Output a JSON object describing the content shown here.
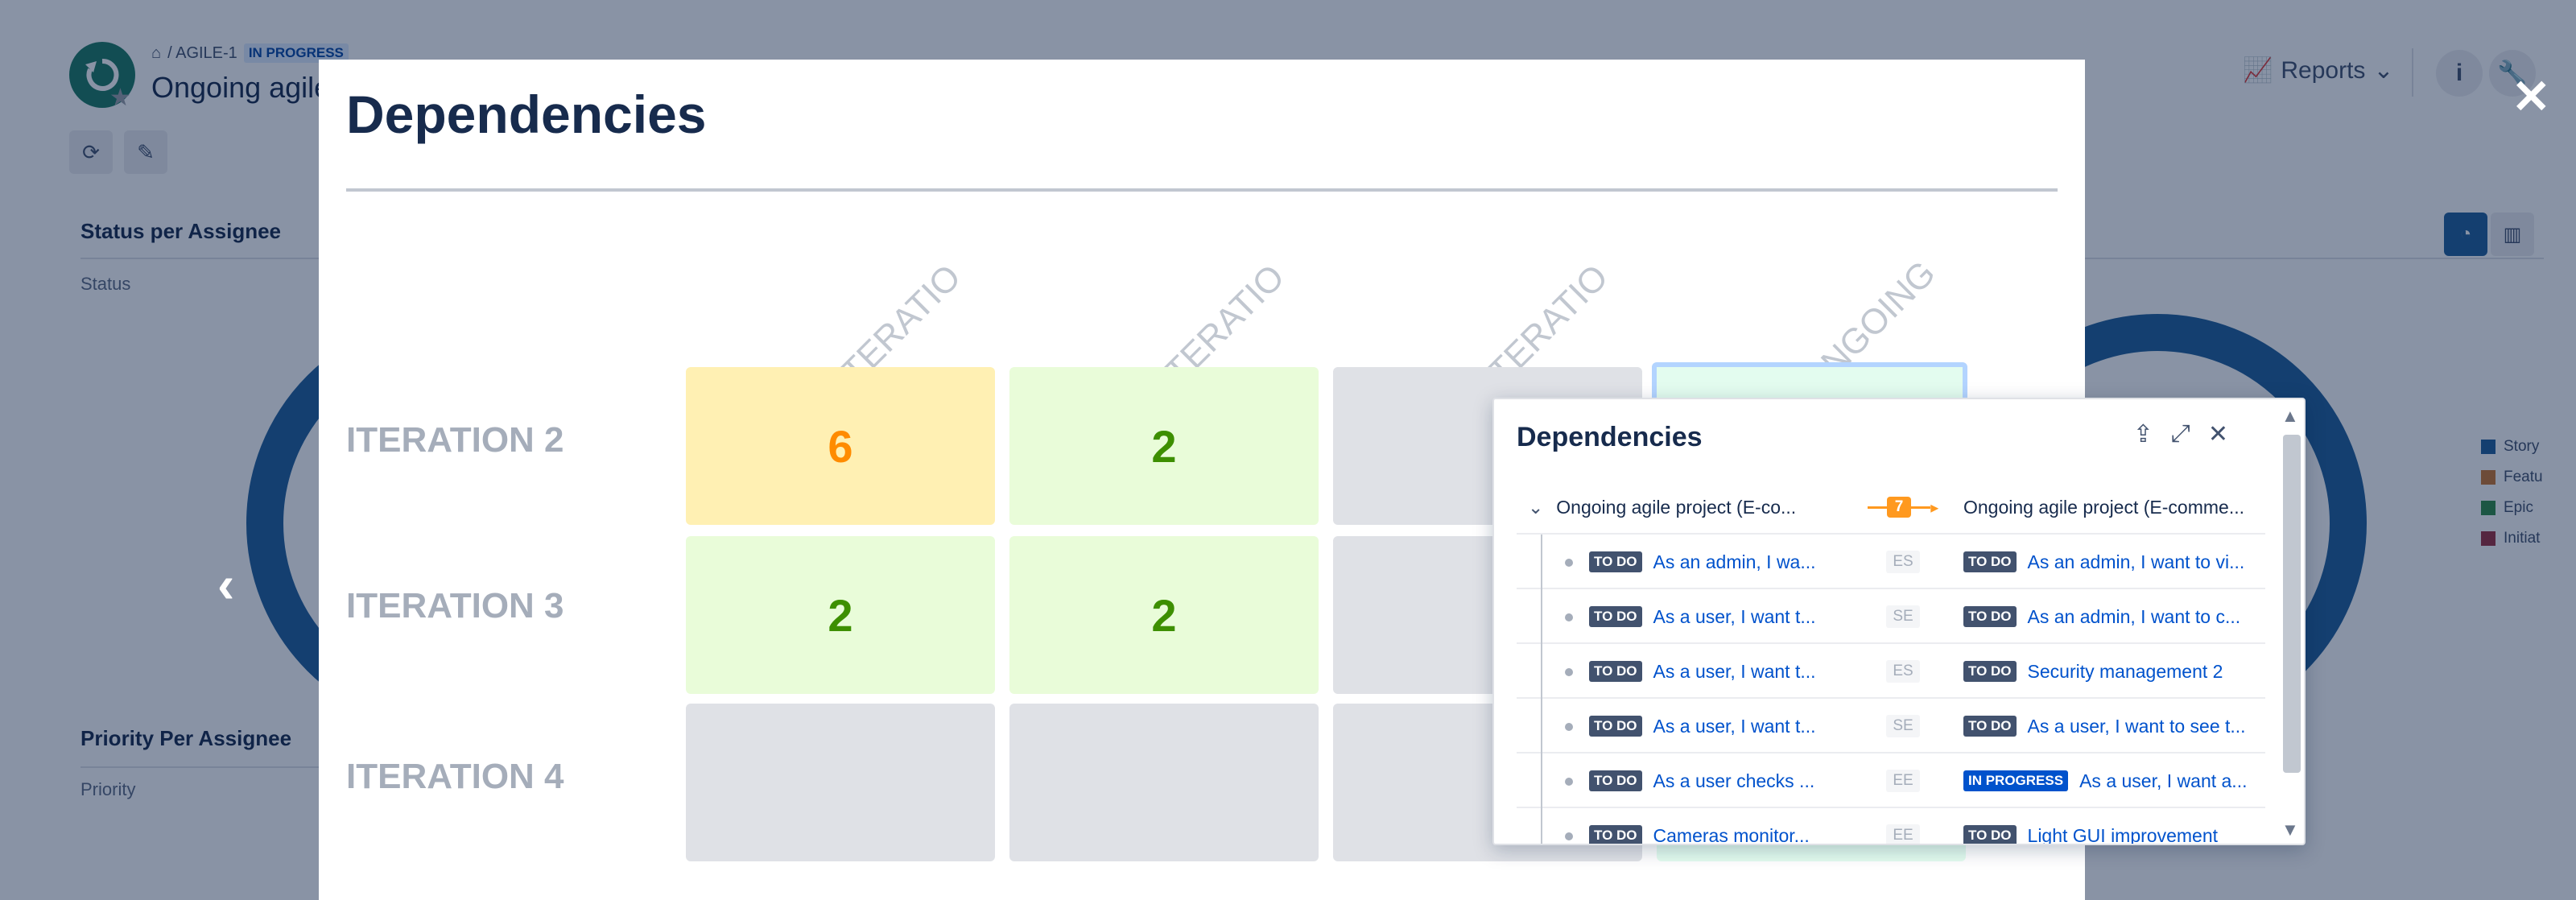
{
  "background": {
    "breadcrumb_key": "/ AGILE-1",
    "status": "IN PROGRESS",
    "title": "Ongoing agile",
    "reports_label": "Reports",
    "info_label": "i",
    "sections": [
      {
        "title": "Status per Assignee",
        "subtitle": "Status"
      },
      {
        "title": "Priority Per Assignee",
        "subtitle": "Priority"
      }
    ],
    "legend": [
      {
        "label": "Story",
        "color": "#1f5e99"
      },
      {
        "label": "Featu",
        "color": "#c9762f"
      },
      {
        "label": "Epic",
        "color": "#2f8a45"
      },
      {
        "label": "Initiat",
        "color": "#9b2f3f"
      }
    ]
  },
  "modal": {
    "title": "Dependencies",
    "column_headers": [
      "ITERATIO",
      "ITERATIO",
      "ITERATIO",
      "ONGOING"
    ],
    "rows": [
      {
        "label": "ITERATION 2",
        "cells": [
          "6",
          "2",
          "",
          ""
        ]
      },
      {
        "label": "ITERATION 3",
        "cells": [
          "2",
          "2",
          "",
          ""
        ]
      },
      {
        "label": "ITERATION 4",
        "cells": [
          "",
          "",
          "",
          ""
        ]
      }
    ]
  },
  "popup": {
    "title": "Dependencies",
    "group": {
      "left": "Ongoing agile project (E-co...",
      "count": "7",
      "right": "Ongoing agile project (E-comme..."
    },
    "items": [
      {
        "left_status": "TO DO",
        "left_text": "As an admin, I wa...",
        "type": "ES",
        "right_status": "TO DO",
        "right_text": "As an admin, I want to vi..."
      },
      {
        "left_status": "TO DO",
        "left_text": "As a user, I want t...",
        "type": "SE",
        "right_status": "TO DO",
        "right_text": "As an admin, I want to c..."
      },
      {
        "left_status": "TO DO",
        "left_text": "As a user, I want t...",
        "type": "ES",
        "right_status": "TO DO",
        "right_text": "Security management 2"
      },
      {
        "left_status": "TO DO",
        "left_text": "As a user, I want t...",
        "type": "SE",
        "right_status": "TO DO",
        "right_text": "As a user, I want to see t..."
      },
      {
        "left_status": "TO DO",
        "left_text": "As a user checks ...",
        "type": "EE",
        "right_status": "IN PROGRESS",
        "right_text": "As a user, I want a..."
      },
      {
        "left_status": "TO DO",
        "left_text": "Cameras monitor...",
        "type": "EE",
        "right_status": "TO DO",
        "right_text": "Light GUI improvement"
      }
    ]
  }
}
